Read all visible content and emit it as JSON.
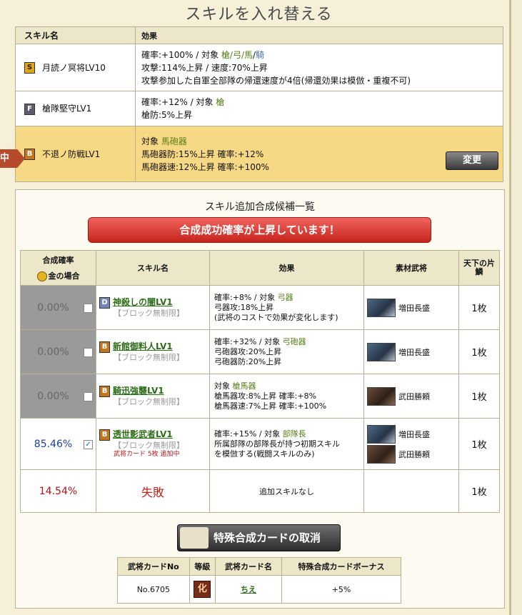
{
  "page": {
    "title": "スキルを入れ替える"
  },
  "current": {
    "headers": [
      "スキル名",
      "効果"
    ],
    "lock_label": "中",
    "change_label": "変更",
    "skills": [
      {
        "rank": "S",
        "name": "月読ノ冥将LV10",
        "line1_a": "確率:+100%  /  対象 ",
        "line1_targets": "槍/弓/馬",
        "line1_sep": "/",
        "line1_extra": "騎",
        "line2": "攻撃:114%上昇 / 速度:70%上昇",
        "line3": "攻撃参加した自軍全部隊の帰還速度が4倍(帰還効果は模倣・重複不可)"
      },
      {
        "rank": "F",
        "name": "槍隊堅守LV1",
        "line1_a": "確率:+12%  /  対象 ",
        "line1_targets": "槍",
        "line2": "槍防:5%上昇"
      },
      {
        "rank": "B",
        "name": "不退ノ防戦LV1",
        "line1_a": "対象 ",
        "line1_targets": "馬砲器",
        "line2": "馬砲器防:15%上昇  確率:+12%",
        "line3": "馬砲器速:12%上昇  確率:+100%"
      }
    ]
  },
  "candidates": {
    "title": "スキル追加合成候補一覧",
    "banner": "合成成功確率が上昇しています！",
    "headers": {
      "rate": "合成確率",
      "gold": "金の場合",
      "skill": "スキル名",
      "effect": "効果",
      "material": "素材武将",
      "pieces": "天下の片鱗"
    },
    "rows": [
      {
        "rate": "0.00%",
        "rank": "D",
        "name": "神殺しの闇LV1",
        "ban": "【ブロック無制限】",
        "eff1_a": "確率:+8%  /  対象 ",
        "eff1_t": "弓器",
        "eff2": "弓器攻:18%上昇",
        "eff3": "(武将のコストで効果が変化します)",
        "material": "増田長盛",
        "pieces": "1枚"
      },
      {
        "rate": "0.00%",
        "rank": "B",
        "name": "新館御料人LV1",
        "ban": "【ブロック無制限】",
        "eff1_a": "確率:+32%  /  対象 ",
        "eff1_t": "弓砲器",
        "eff2": "弓砲器攻:20%上昇",
        "eff3": "弓砲器防:20%上昇",
        "material": "増田長盛",
        "pieces": "1枚"
      },
      {
        "rate": "0.00%",
        "rank": "B",
        "name": "騎迅強襲LV1",
        "ban": "【ブロック無制限】",
        "eff1_a": "対象 ",
        "eff1_t": "槍馬器",
        "eff2": "槍馬器攻:8%上昇  確率:+8%",
        "eff3": "槍馬器速:7%上昇  確率:+100%",
        "material": "武田勝頼",
        "pieces": "1枚"
      },
      {
        "rate": "85.46%",
        "rank": "B",
        "name": "透世影武者LV1",
        "ban": "【ブロック無制限】",
        "card": "武将カード 5枚 追加中",
        "eff1_a": "確率:+15%  /  対象 ",
        "eff1_t": "部隊長",
        "eff2": "所属部隊の部隊長が持つ初期スキル",
        "eff3": "を模倣する(戦闘スキルのみ)",
        "material": "増田長盛",
        "material2": "武田勝頼",
        "pieces": "1枚"
      }
    ],
    "fail": {
      "rate": "14.54%",
      "label": "失敗",
      "effect": "追加スキルなし",
      "pieces": "1枚"
    }
  },
  "special": {
    "cancel_label": "特殊合成カードの取消",
    "headers": [
      "武将カードNo",
      "等級",
      "武将カード名",
      "特殊合成カードボーナス"
    ],
    "row": {
      "no": "No.6705",
      "grade": "化",
      "name": "ちえ",
      "bonus": "+5%"
    }
  },
  "colors": {
    "target_green": "#5a7d17",
    "target_blue": "#4b6fb3",
    "banner_red": "#d83029",
    "fail_red": "#b01414"
  }
}
